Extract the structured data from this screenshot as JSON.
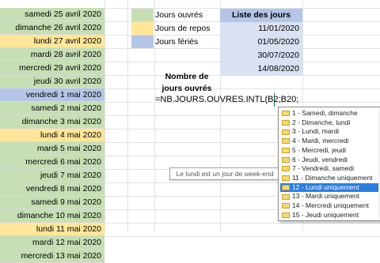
{
  "dates": [
    {
      "label": "samedi 25 avril 2020",
      "fill": "green"
    },
    {
      "label": "dimanche 26 avril 2020",
      "fill": "green"
    },
    {
      "label": "lundi 27 avril 2020",
      "fill": "yellow"
    },
    {
      "label": "mardi 28 avril 2020",
      "fill": "green"
    },
    {
      "label": "mercredi 29 avril 2020",
      "fill": "green"
    },
    {
      "label": "jeudi 30 avril 2020",
      "fill": "green"
    },
    {
      "label": "vendredi 1 mai 2020",
      "fill": "blue"
    },
    {
      "label": "samedi 2 mai 2020",
      "fill": "green"
    },
    {
      "label": "dimanche 3 mai 2020",
      "fill": "green"
    },
    {
      "label": "lundi 4 mai 2020",
      "fill": "yellow"
    },
    {
      "label": "mardi 5 mai 2020",
      "fill": "green"
    },
    {
      "label": "mercredi 6 mai 2020",
      "fill": "green"
    },
    {
      "label": "jeudi 7 mai 2020",
      "fill": "green"
    },
    {
      "label": "vendredi 8 mai 2020",
      "fill": "green"
    },
    {
      "label": "samedi 9 mai 2020",
      "fill": "green"
    },
    {
      "label": "dimanche 10 mai 2020",
      "fill": "green"
    },
    {
      "label": "lundi 11 mai 2020",
      "fill": "yellow"
    },
    {
      "label": "mardi 12 mai 2020",
      "fill": "green"
    },
    {
      "label": "mercredi 13 mai 2020",
      "fill": "green"
    }
  ],
  "legend": [
    {
      "label": "Jours ouvrés",
      "color": "#c6dfb4"
    },
    {
      "label": "Jours de repos",
      "color": "#ffe699"
    },
    {
      "label": "Jours fériés",
      "color": "#b4c6e7"
    }
  ],
  "holidays": {
    "title": "Liste des jours fériés",
    "dates": [
      "11/01/2020",
      "01/05/2020",
      "30/07/2020",
      "14/08/2020"
    ]
  },
  "result": {
    "title_line1": "Nombre de",
    "title_line2": "jours ouvrés",
    "formula": "=NB.JOURS.OUVRES.INTL(B2;B20;"
  },
  "tooltip": "Le lundi est un jour de week-end",
  "dropdown": {
    "selected_index": 8,
    "items": [
      "1 - Samedi, dimanche",
      "2 - Dimanche, lundi",
      "3 - Lundi, mardi",
      "4 - Mardi, mercredi",
      "5 - Mercredi, jeudi",
      "6 - Jeudi, vendredi",
      "7 - Vendredi, samedi",
      "11 - Dimanche uniquement",
      "12 - Lundi uniquement",
      "13 - Mardi uniquement",
      "14 - Mercredi uniquement",
      "15 - Jeudi uniquement"
    ]
  }
}
